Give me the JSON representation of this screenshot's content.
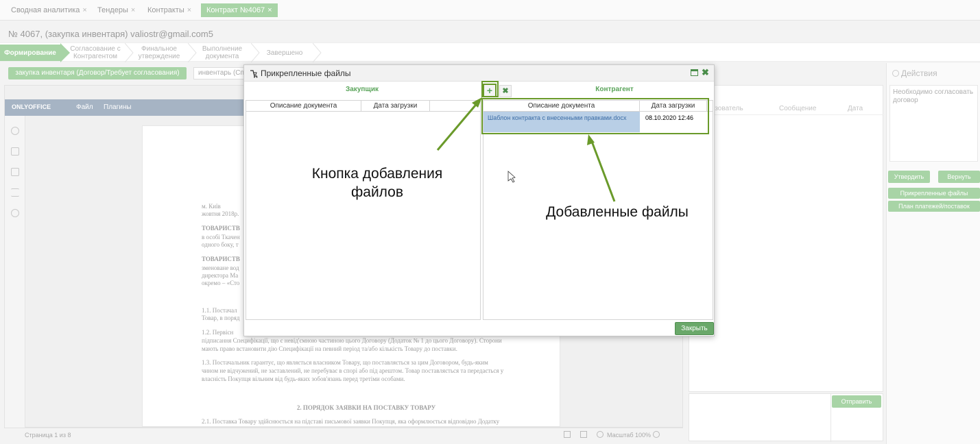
{
  "tabs": [
    {
      "label": "Сводная аналитика",
      "active": false
    },
    {
      "label": "Тендеры",
      "active": false
    },
    {
      "label": "Контракты",
      "active": false
    },
    {
      "label": "Контракт №4067",
      "active": true
    }
  ],
  "tab_close_glyph": "×",
  "document_title": "№ 4067, (закупка инвентаря) valiostr@gmail.com5",
  "stages": [
    {
      "line1": "Формирование",
      "line2": ""
    },
    {
      "line1": "Согласование с",
      "line2": "Контрагентом"
    },
    {
      "line1": "Финальное",
      "line2": "утверждение"
    },
    {
      "line1": "Выполнение",
      "line2": "документа"
    },
    {
      "line1": "Завершено",
      "line2": ""
    }
  ],
  "status_button": "закупка инвентаря (Договор/Требует согласования)",
  "inventory_field": "инвентарь (Сп",
  "editor": {
    "logo": "ONLYOFFICE",
    "menu": [
      "Файл",
      "Плагины"
    ],
    "page_lines": [
      "м. Київ",
      "жовтня 2018р.",
      "ТОВАРИСТВ",
      "в особі Ткачен",
      "одного боку, т",
      "ТОВАРИСТВ",
      "зменоване вод",
      "директора Ма",
      "окремо – «Сто",
      "1.1. Постачал",
      "Товар, в поряд",
      "1.2. Первісн",
      "підписання Специфікації, що є невід'ємною частиною цього Договору (Додаток № 1 до цього Договору). Сторони",
      "мають право встановити дію Специфікації на певний період та/або кількість Товару до поставки.",
      "1.3. Постачальник гарантує, що являється власником Товару, що поставляється за цим Договором, будь-яким",
      "чином не відчужений, не заставлений, не перебуває в спорі або під арештом. Товар поставляється та передається у",
      "власність Покупця вільним від будь-яких зобов'язань перед третіми особами.",
      "2. ПОРЯДОК ЗАЯВКИ НА ПОСТАВКУ ТОВАРУ",
      "2.1. Поставка Товару здійснюється на підставі письмової заявки Покупця, яка оформлюється відповідно Додатку"
    ],
    "page_status": "Страница 1 из 8",
    "zoom": "Масштаб 100%"
  },
  "history_columns": [
    "...зователь",
    "Сообщение",
    "Дата"
  ],
  "send_button": "Отправить",
  "actions": {
    "title": "Действия",
    "note": "Необходимо согласовать договор",
    "approve": "Утвердить",
    "return": "Вернуть",
    "attached_files": "Прикрепленные файлы",
    "payment_plan": "План платежей/поставок"
  },
  "modal": {
    "title": "Прикрепленные файлы",
    "buyer": {
      "title": "Закупщик",
      "columns": [
        "Описание документа",
        "Дата загрузки"
      ]
    },
    "counterparty": {
      "title": "Контрагент",
      "columns": [
        "Описание документа",
        "Дата загрузки"
      ],
      "files": [
        {
          "name": "Шаблон контракта с внесенными правками.docx",
          "date": "08.10.2020 12:46"
        }
      ]
    },
    "add_glyph": "+",
    "delete_glyph": "✖",
    "close_button": "Закрыть"
  },
  "annotations": {
    "add_files": [
      "Кнопка добавления",
      "файлов"
    ],
    "added_files": "Добавленные файлы"
  },
  "colors": {
    "accent_green": "#a8d4a6",
    "annotation_green": "#6a9a2a",
    "selected_row": "#b9cfe6"
  }
}
